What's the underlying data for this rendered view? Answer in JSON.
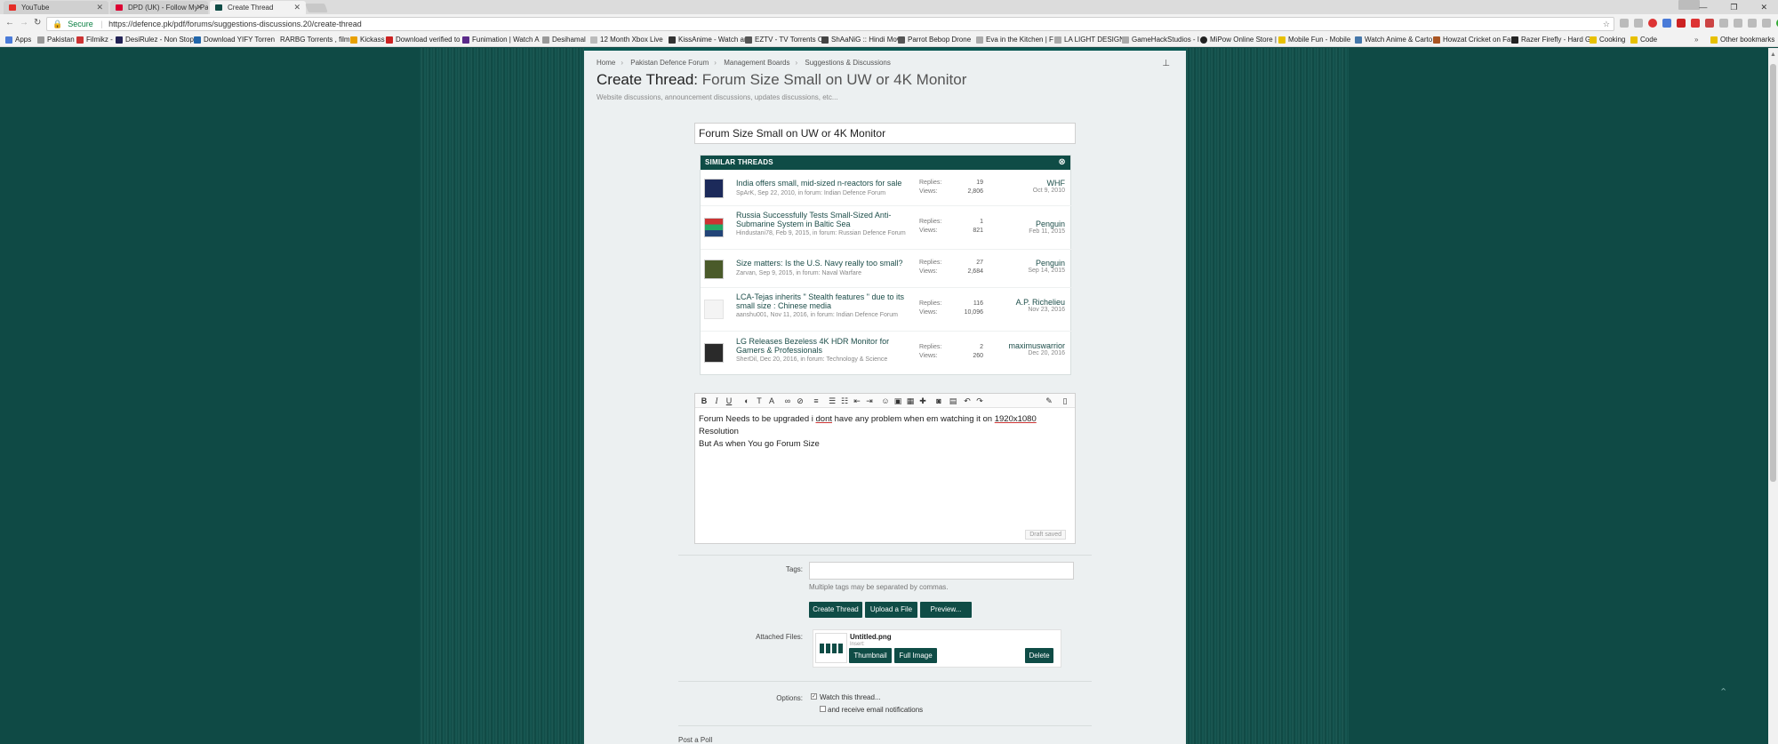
{
  "browser": {
    "tabs": [
      {
        "label": "YouTube",
        "favicon_color": "#e52d27"
      },
      {
        "label": "DPD (UK) - Follow My Pa",
        "favicon_color": "#dc0032"
      },
      {
        "label": "Create Thread",
        "favicon_color": "#0f4c46"
      }
    ],
    "user_chip": "",
    "url_secure": "Secure",
    "url": "https://defence.pk/pdf/forums/suggestions-discussions.20/create-thread",
    "bookmarks": [
      "Apps",
      "Pakistan",
      "Filmikz -",
      "DesiRulez - Non Stop",
      "Download YIFY Torren",
      "RARBG Torrents , film",
      "Kickass",
      "Download verified to",
      "Funimation | Watch A",
      "Desihamal",
      "12 Month Xbox Live",
      "KissAnime - Watch ar",
      "EZTV - TV Torrents O",
      "ShAaNiG :: Hindi Mov",
      "Parrot Bebop Drone",
      "Eva in the Kitchen | F",
      "LA LIGHT DESIGNS",
      "GameHackStudios - I",
      "MiPow Online Store |",
      "Mobile Fun - Mobile",
      "Watch Anime & Carto",
      "Howzat Cricket on Fa",
      "Razer Firefly - Hard G",
      "Cooking",
      "Code",
      "Other bookmarks"
    ]
  },
  "breadcrumb": [
    "Home",
    "Pakistan Defence Forum",
    "Management Boards",
    "Suggestions & Discussions"
  ],
  "page": {
    "title_prefix": "Create Thread:",
    "title_name": "Forum Size Small on UW or 4K Monitor",
    "description": "Website discussions, announcement discussions, updates discussions, etc..."
  },
  "thread_title_value": "Forum Size Small on UW or 4K Monitor",
  "similar": {
    "heading": "SIMILAR THREADS",
    "replies_label": "Replies:",
    "views_label": "Views:",
    "rows": [
      {
        "title": "India offers small, mid-sized n-reactors for sale",
        "meta": "SpArK, Sep 22, 2010, in forum: Indian Defence Forum",
        "replies": "19",
        "views": "2,806",
        "user": "WHF",
        "date": "Oct 9, 2010"
      },
      {
        "title": "Russia Successfully Tests Small-Sized Anti-Submarine System in Baltic Sea",
        "meta": "Hindustani78, Feb 9, 2015, in forum: Russian Defence Forum",
        "replies": "1",
        "views": "821",
        "user": "Penguin",
        "date": "Feb 11, 2015"
      },
      {
        "title": "Size matters: Is the U.S. Navy really too small?",
        "meta": "Zarvan, Sep 9, 2015, in forum: Naval Warfare",
        "replies": "27",
        "views": "2,684",
        "user": "Penguin",
        "date": "Sep 14, 2015"
      },
      {
        "title": "LCA-Tejas inherits \" Stealth features \" due to its small size : Chinese media",
        "meta": "aanshu001, Nov 11, 2016, in forum: Indian Defence Forum",
        "replies": "116",
        "views": "10,096",
        "user": "A.P. Richelieu",
        "date": "Nov 23, 2016"
      },
      {
        "title": "LG Releases Bezeless 4K HDR Monitor for Gamers & Professionals",
        "meta": "SherDil, Dec 20, 2016, in forum: Technology & Science",
        "replies": "2",
        "views": "260",
        "user": "maximuswarrior",
        "date": "Dec 20, 2016"
      }
    ]
  },
  "editor": {
    "line1_a": "Forum Needs to be upgraded i ",
    "line1_spell": "dont",
    "line1_b": " have any problem when em watching it on ",
    "line1_res": "1920x1080",
    "line2": "Resolution",
    "line3": "But As when You go Forum Size",
    "draft_saved": "Draft saved"
  },
  "tags": {
    "label": "Tags:",
    "value": "",
    "hint": "Multiple tags may be separated by commas."
  },
  "buttons": {
    "create": "Create Thread",
    "upload": "Upload a File",
    "preview": "Preview..."
  },
  "attached": {
    "label": "Attached Files:",
    "file_name": "Untitled.png",
    "insert_label": "Insert:",
    "thumbnail": "Thumbnail",
    "full_image": "Full Image",
    "delete": "Delete"
  },
  "options": {
    "label": "Options:",
    "watch": "Watch this thread...",
    "email": "and receive email notifications",
    "watch_checked": true,
    "email_checked": false
  },
  "post_poll": "Post a Poll",
  "colors": {
    "brand": "#0f4c46",
    "link": "#1c4d49"
  }
}
